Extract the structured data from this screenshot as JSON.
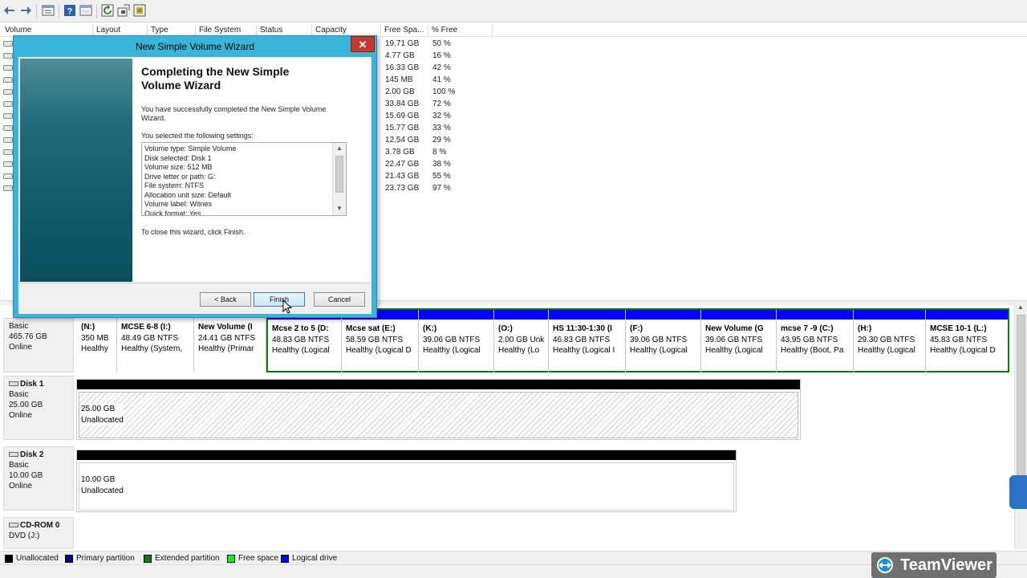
{
  "toolbar": {
    "icons": [
      "back-arrow-icon",
      "forward-arrow-icon",
      "properties-icon",
      "help-icon",
      "list-view-icon",
      "refresh-icon",
      "rescan-icon",
      "settings-icon"
    ]
  },
  "volume_list": {
    "columns": [
      "Volume",
      "Layout",
      "Type",
      "File System",
      "Status",
      "Capacity",
      "Free Spa...",
      "% Free"
    ],
    "rows": [
      {
        "free": "19.71 GB",
        "pct": "50 %"
      },
      {
        "free": "4.77 GB",
        "pct": "16 %"
      },
      {
        "free": "16.33 GB",
        "pct": "42 %"
      },
      {
        "free": "145 MB",
        "pct": "41 %"
      },
      {
        "free": "2.00 GB",
        "pct": "100 %"
      },
      {
        "free": "33.84 GB",
        "pct": "72 %"
      },
      {
        "free": "15.69 GB",
        "pct": "32 %"
      },
      {
        "free": "15.77 GB",
        "pct": "33 %"
      },
      {
        "free": "12.54 GB",
        "pct": "29 %"
      },
      {
        "free": "3.78 GB",
        "pct": "8 %"
      },
      {
        "free": "22.47 GB",
        "pct": "38 %"
      },
      {
        "free": "21.43 GB",
        "pct": "55 %"
      },
      {
        "free": "23.73 GB",
        "pct": "97 %"
      }
    ]
  },
  "disks": [
    {
      "name": "",
      "type": "Basic",
      "size": "465.76 GB",
      "state": "Online",
      "partitions": [
        {
          "name": "(N:)",
          "size": "350 MB",
          "status": "Healthy"
        },
        {
          "name": "MCSE 6-8  (I:)",
          "size": "48.49 GB NTFS",
          "status": "Healthy (System,"
        },
        {
          "name": "New Volume  (I",
          "size": "24.41 GB NTFS",
          "status": "Healthy (Primar"
        },
        {
          "name": "Mcse  2 to 5  (D:",
          "size": "48.83 GB NTFS",
          "status": "Healthy (Logical"
        },
        {
          "name": "Mcse sat  (E:)",
          "size": "58.59 GB NTFS",
          "status": "Healthy (Logical D"
        },
        {
          "name": "(K:)",
          "size": "39.06 GB NTFS",
          "status": "Healthy (Logical"
        },
        {
          "name": "(O:)",
          "size": "2.00 GB Unk",
          "status": "Healthy (Lo"
        },
        {
          "name": "HS 11:30-1:30  (I",
          "size": "46.83 GB NTFS",
          "status": "Healthy (Logical I"
        },
        {
          "name": "(F:)",
          "size": "39.06 GB NTFS",
          "status": "Healthy (Logical"
        },
        {
          "name": "New Volume  (G",
          "size": "39.06 GB NTFS",
          "status": "Healthy (Logical"
        },
        {
          "name": "mcse 7 -9  (C:)",
          "size": "43.95 GB NTFS",
          "status": "Healthy (Boot, Pa"
        },
        {
          "name": "(H:)",
          "size": "29.30 GB NTFS",
          "status": "Healthy (Logical"
        },
        {
          "name": "MCSE 10-1  (L:)",
          "size": "45.83 GB NTFS",
          "status": "Healthy (Logical D"
        }
      ]
    },
    {
      "name": "Disk 1",
      "type": "Basic",
      "size": "25.00 GB",
      "state": "Online",
      "unalloc_size": "25.00 GB",
      "unalloc_label": "Unallocated"
    },
    {
      "name": "Disk 2",
      "type": "Basic",
      "size": "10.00 GB",
      "state": "Online",
      "unalloc_size": "10.00 GB",
      "unalloc_label": "Unallocated"
    },
    {
      "name": "CD-ROM 0",
      "type": "DVD (J:)"
    }
  ],
  "legend": [
    {
      "label": "Unallocated",
      "color": "#000000"
    },
    {
      "label": "Primary partition",
      "color": "#00007f"
    },
    {
      "label": "Extended partition",
      "color": "#007f00"
    },
    {
      "label": "Free space",
      "color": "#00ff00"
    },
    {
      "label": "Logical drive",
      "color": "#0000ff"
    }
  ],
  "colors": {
    "primary": "#00007f",
    "logical": "#0000ff",
    "extended": "#008000",
    "unallocated": "#000000",
    "dialog_frame": "#39b5d9"
  },
  "wizard": {
    "title": "New Simple Volume Wizard",
    "close": "✕",
    "heading": "Completing the New Simple Volume Wizard",
    "success_text": "You have successfully completed the New Simple Volume Wizard.",
    "settings_intro": "You selected the following settings:",
    "settings": [
      "Volume type: Simple Volume",
      "Disk selected: Disk 1",
      "Volume size: 512 MB",
      "Drive letter or path: G:",
      "File system: NTFS",
      "Allocation unit size: Default",
      "Volume label: Witnes",
      "Quick format: Yes"
    ],
    "close_text": "To close this wizard, click Finish.",
    "buttons": {
      "back": "< Back",
      "finish": "Finish",
      "cancel": "Cancel"
    }
  },
  "teamviewer": {
    "label": "TeamViewer"
  }
}
